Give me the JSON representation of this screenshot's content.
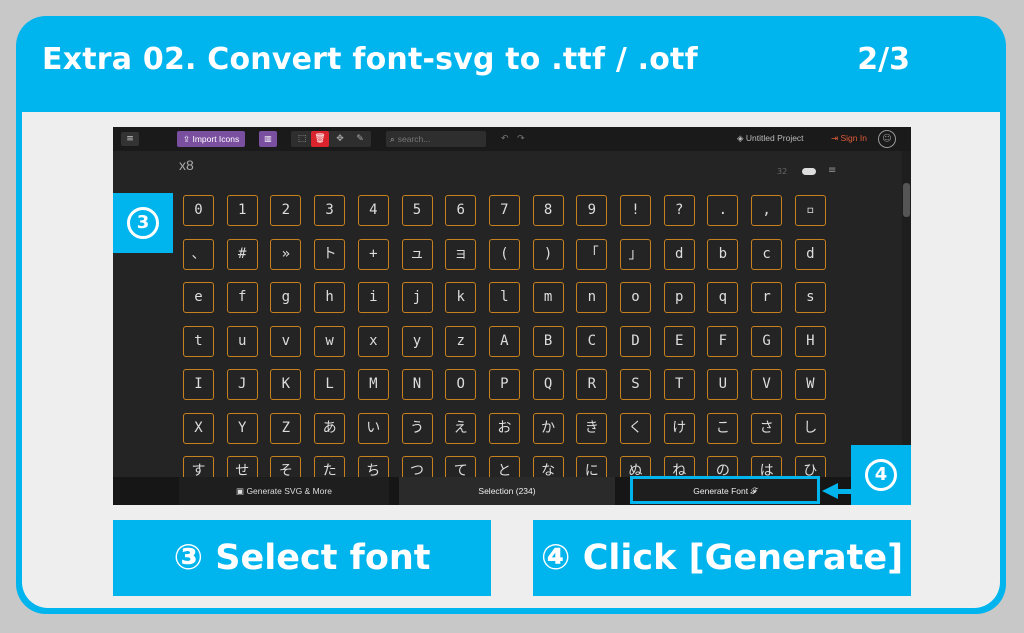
{
  "header": {
    "title": "Extra 02. Convert font-svg to .ttf / .otf",
    "page": "2/3"
  },
  "app": {
    "import_label": "Import Icons",
    "search_placeholder": "search...",
    "project_label": "Untitled Project",
    "signin_label": "Sign In",
    "set_name": "x8",
    "set_count": "32"
  },
  "glyph_rows": [
    [
      "0",
      "1",
      "2",
      "3",
      "4",
      "5",
      "6",
      "7",
      "8",
      "9",
      "!",
      "?",
      ".",
      ",",
      "▫"
    ],
    [
      "、",
      "#",
      "»",
      "ト",
      "+",
      "ュ",
      "ョ",
      "(",
      ")",
      "「",
      "」",
      "d",
      "b",
      "c",
      "d"
    ],
    [
      "e",
      "f",
      "g",
      "h",
      "i",
      "j",
      "k",
      "l",
      "m",
      "n",
      "o",
      "p",
      "q",
      "r",
      "s"
    ],
    [
      "t",
      "u",
      "v",
      "w",
      "x",
      "y",
      "z",
      "A",
      "B",
      "C",
      "D",
      "E",
      "F",
      "G",
      "H"
    ],
    [
      "I",
      "J",
      "K",
      "L",
      "M",
      "N",
      "O",
      "P",
      "Q",
      "R",
      "S",
      "T",
      "U",
      "V",
      "W"
    ],
    [
      "X",
      "Y",
      "Z",
      "あ",
      "い",
      "う",
      "え",
      "お",
      "か",
      "き",
      "く",
      "け",
      "こ",
      "さ",
      "し"
    ],
    [
      "す",
      "せ",
      "そ",
      "た",
      "ち",
      "つ",
      "て",
      "と",
      "な",
      "に",
      "ぬ",
      "ね",
      "の",
      "は",
      "ひ"
    ]
  ],
  "bottom_bar": {
    "generate_svg": "Generate SVG & More",
    "selection": "Selection (234)",
    "generate_font": "Generate Font"
  },
  "badges": {
    "step3": "3",
    "step4": "4"
  },
  "steps": {
    "step3": "③ Select font",
    "step4": "④ Click [Generate]"
  },
  "colors": {
    "accent": "#00b4ee",
    "tile_border": "#c8811f",
    "purple": "#7b4fa0"
  }
}
